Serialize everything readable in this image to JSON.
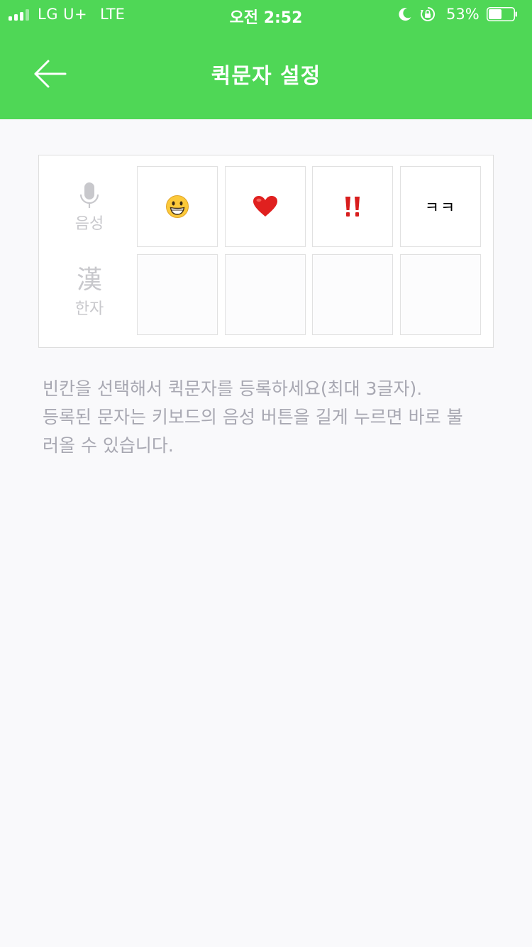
{
  "status_bar": {
    "carrier": "LG U+",
    "network": "LTE",
    "time": "오전 2:52",
    "battery_percent_text": "53%",
    "battery_level": 0.53,
    "signal_bars_filled": 3,
    "signal_bars_total": 4,
    "icons": [
      "signal-icon",
      "moon-icon",
      "rotation-lock-icon",
      "battery-icon"
    ]
  },
  "header": {
    "title": "퀵문자 설정",
    "back_icon": "back-arrow-icon",
    "background_color": "#4fd756"
  },
  "grid": {
    "rows": [
      {
        "label": "음성",
        "icon": "microphone-icon",
        "cells": [
          {
            "type": "emoji",
            "icon": "grinning-face-emoji-icon",
            "text": ""
          },
          {
            "type": "emoji",
            "icon": "red-heart-emoji-icon",
            "text": ""
          },
          {
            "type": "emoji",
            "icon": "double-exclamation-emoji-icon",
            "text": ""
          },
          {
            "type": "text",
            "icon": "",
            "text": "ㅋㅋ"
          }
        ]
      },
      {
        "label": "한자",
        "glyph": "漢",
        "cells": [
          {
            "type": "empty",
            "text": ""
          },
          {
            "type": "empty",
            "text": ""
          },
          {
            "type": "empty",
            "text": ""
          },
          {
            "type": "empty",
            "text": ""
          }
        ]
      }
    ]
  },
  "help": {
    "line1": "빈칸을 선택해서 퀵문자를 등록하세요(최대 3글자).",
    "line2": "등록된 문자는 키보드의 음성 버튼을 길게 누르면 바로 불",
    "line3": "러올 수 있습니다."
  },
  "colors": {
    "accent": "#4fd756",
    "background": "#f9f9fb",
    "help_text": "#a8a8b2",
    "label_gray": "#c8c8cc"
  }
}
